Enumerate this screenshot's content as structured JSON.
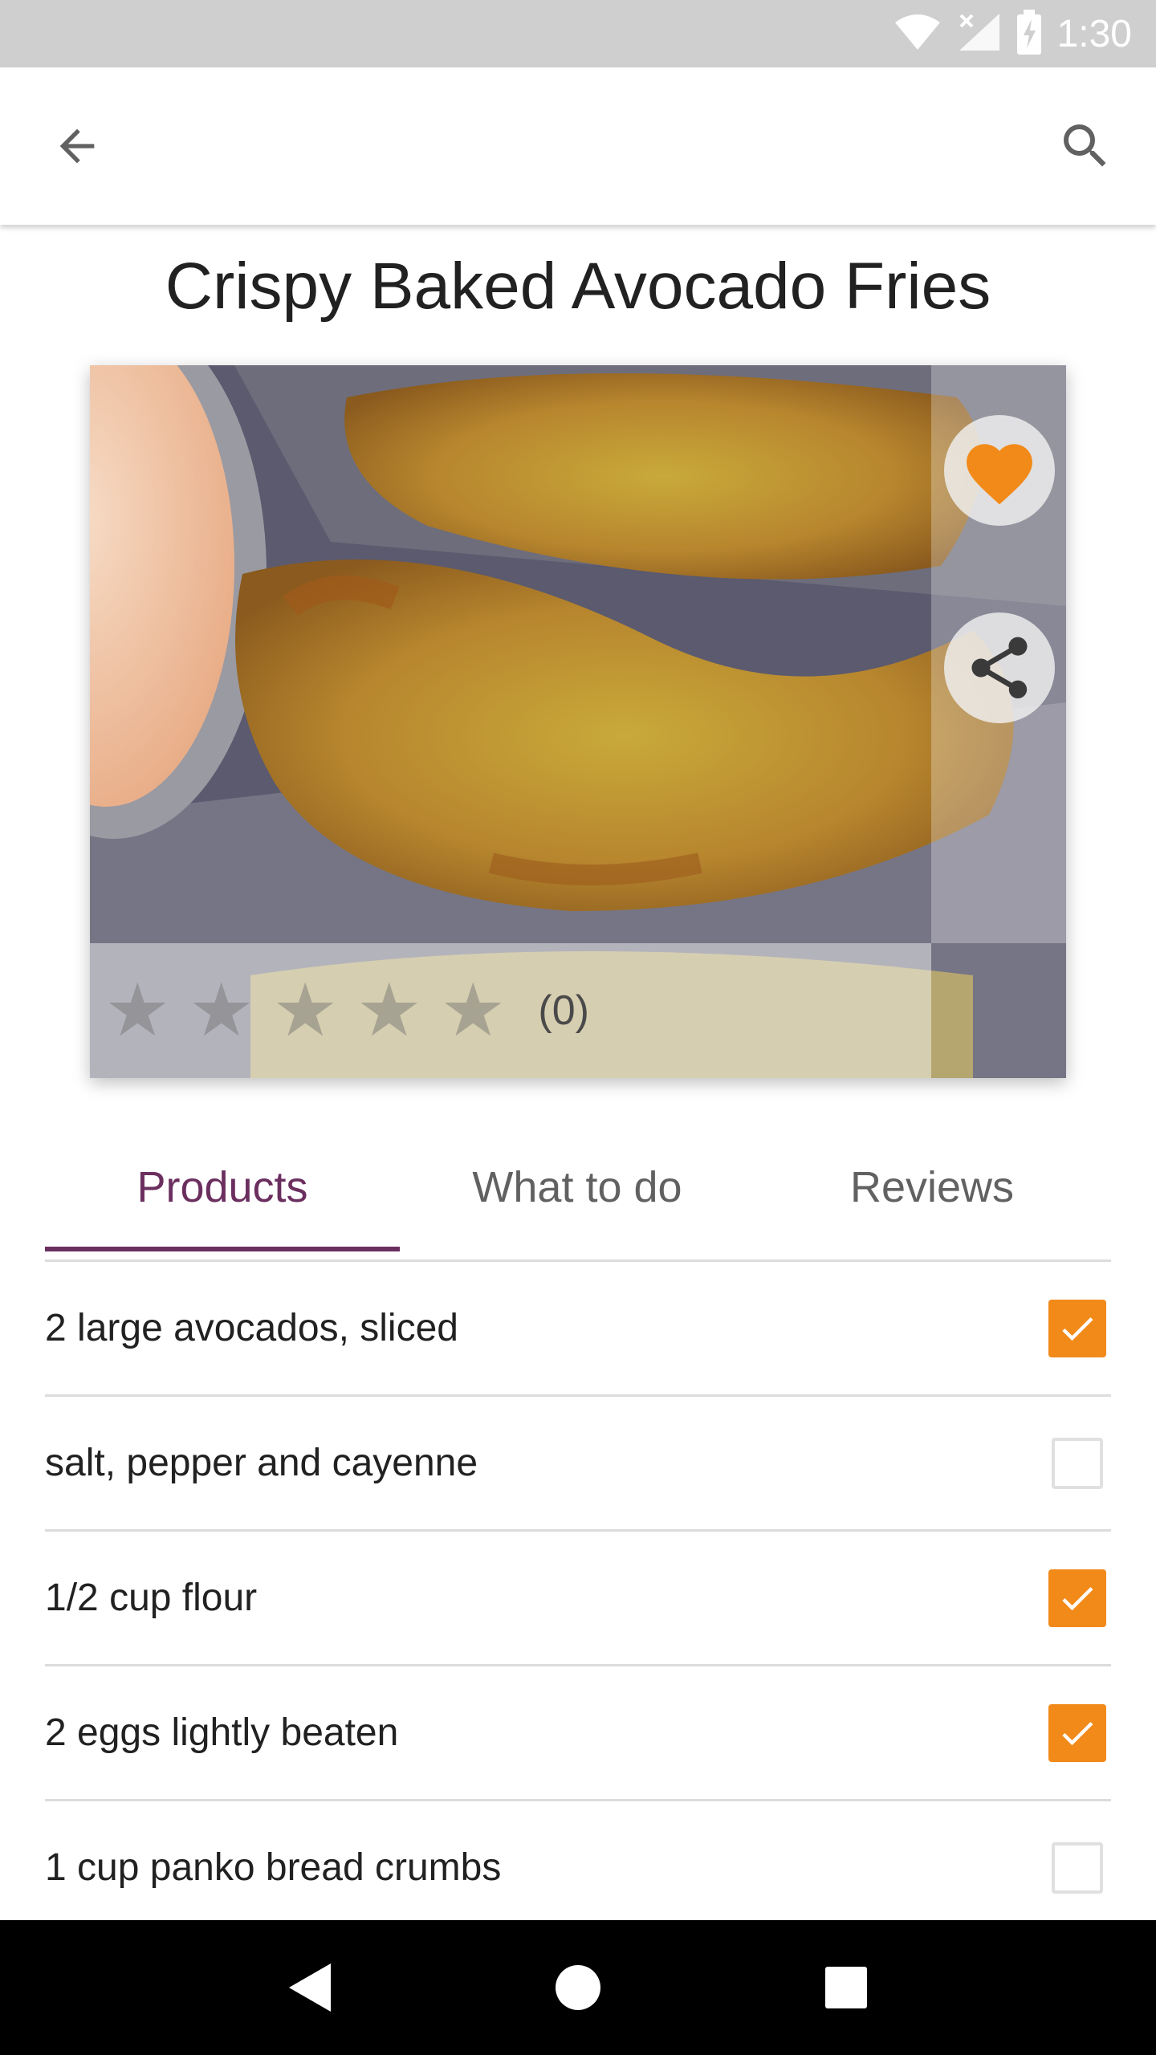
{
  "status_bar": {
    "time": "1:30",
    "icons": [
      "wifi-icon",
      "signal-icon",
      "battery-charging-icon"
    ]
  },
  "app_bar": {
    "back_icon": "arrow-back-icon",
    "search_icon": "search-icon"
  },
  "recipe": {
    "title": "Crispy Baked Avocado Fries",
    "rating": {
      "value": 0,
      "max": 5,
      "count_label": "(0)"
    },
    "favorite_icon": "heart-icon",
    "share_icon": "share-icon"
  },
  "tabs": [
    {
      "label": "Products",
      "active": true
    },
    {
      "label": "What to do",
      "active": false
    },
    {
      "label": "Reviews",
      "active": false
    }
  ],
  "ingredients": [
    {
      "label": "2 large avocados, sliced",
      "checked": true
    },
    {
      "label": "salt, pepper and cayenne",
      "checked": false
    },
    {
      "label": "1/2 cup flour",
      "checked": true
    },
    {
      "label": "2 eggs lightly beaten",
      "checked": true
    },
    {
      "label": "1 cup panko bread crumbs",
      "checked": false
    }
  ],
  "nav_bar": {
    "icons": [
      "back-triangle-icon",
      "home-circle-icon",
      "recents-square-icon"
    ]
  },
  "colors": {
    "accent": "#f28a1a",
    "tab_active": "#6b2f5f",
    "status_bar": "#cfcfcf"
  }
}
